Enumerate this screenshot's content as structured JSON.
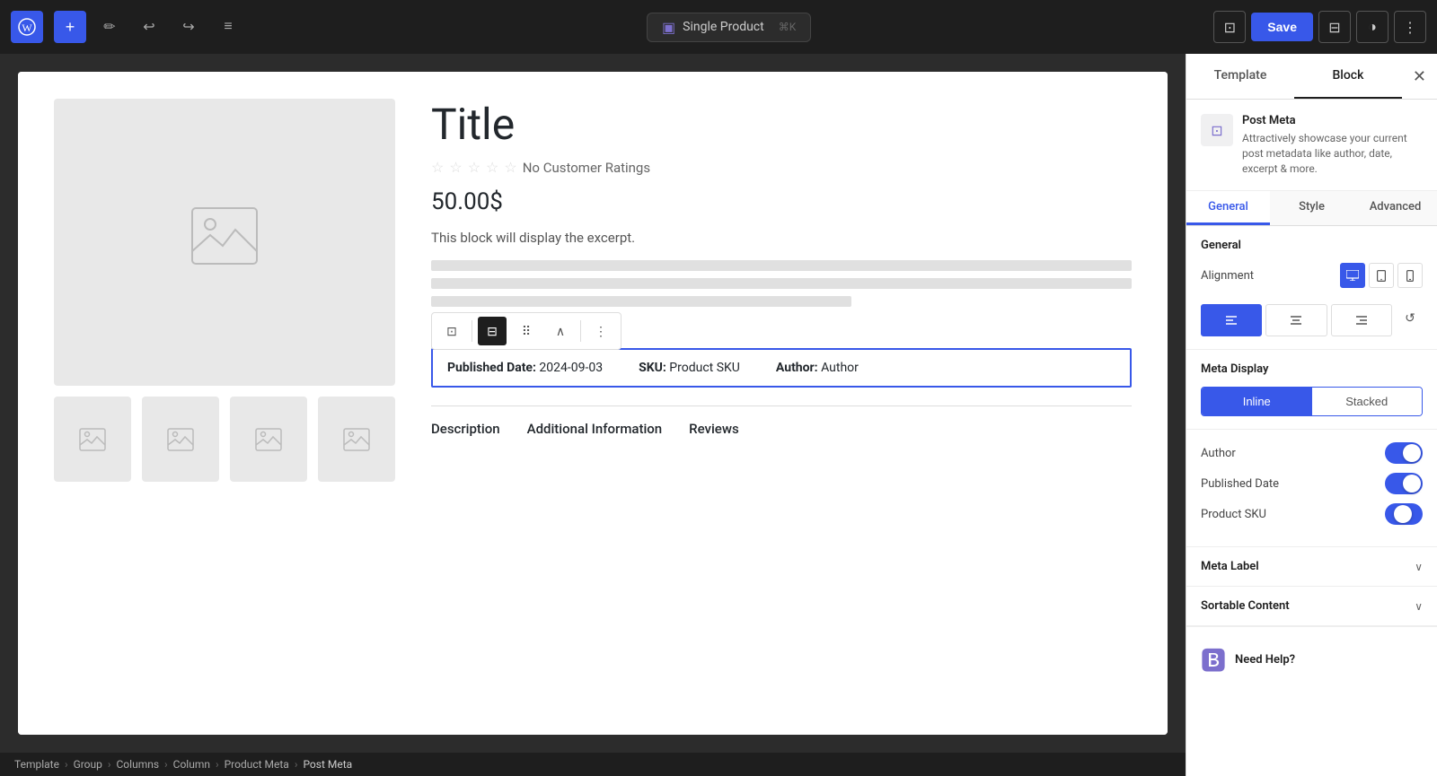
{
  "topbar": {
    "wp_logo": "W",
    "add_label": "+",
    "pencil_label": "✏",
    "undo_label": "↩",
    "redo_label": "↪",
    "list_label": "≡",
    "template_pill": {
      "icon": "▣",
      "label": "Single Product",
      "shortcut": "⌘K"
    },
    "save_label": "Save",
    "view_icon": "⊡",
    "sidebar_icon": "⊟",
    "contrast_icon": "◑",
    "more_icon": "⋮"
  },
  "panel": {
    "template_tab": "Template",
    "block_tab": "Block",
    "close_icon": "✕",
    "block_icon": "⊡",
    "block_name": "Post Meta",
    "block_desc": "Attractively showcase your current post metadata like author, date, excerpt & more.",
    "sub_tabs": [
      "General",
      "Style",
      "Advanced"
    ],
    "active_sub_tab": "General",
    "general_section": {
      "title": "General",
      "alignment_label": "Alignment",
      "devices": [
        "desktop",
        "tablet",
        "mobile"
      ],
      "align_options": [
        "left",
        "center",
        "right"
      ],
      "align_icons": [
        "≡",
        "≡",
        "≡"
      ],
      "active_align": 0
    },
    "meta_display": {
      "label": "Meta Display",
      "options": [
        "Inline",
        "Stacked"
      ],
      "active": "Inline"
    },
    "toggles": {
      "author": {
        "label": "Author",
        "state": "on"
      },
      "published_date": {
        "label": "Published Date",
        "state": "on"
      },
      "product_sku": {
        "label": "Product SKU",
        "state": "half"
      }
    },
    "meta_label_section": "Meta Label",
    "sortable_section": "Sortable Content",
    "need_help": "Need Help?"
  },
  "product": {
    "title": "Title",
    "no_ratings": "No Customer Ratings",
    "price": "50.00$",
    "excerpt": "This block will display the excerpt.",
    "meta": {
      "published_date_label": "Published Date:",
      "published_date_value": "2024-09-03",
      "sku_label": "SKU:",
      "sku_value": "Product SKU",
      "author_label": "Author:",
      "author_value": "Author"
    },
    "tabs": [
      "Description",
      "Additional Information",
      "Reviews"
    ]
  },
  "breadcrumb": {
    "items": [
      "Template",
      "Group",
      "Columns",
      "Column",
      "Product Meta",
      "Post Meta"
    ]
  }
}
